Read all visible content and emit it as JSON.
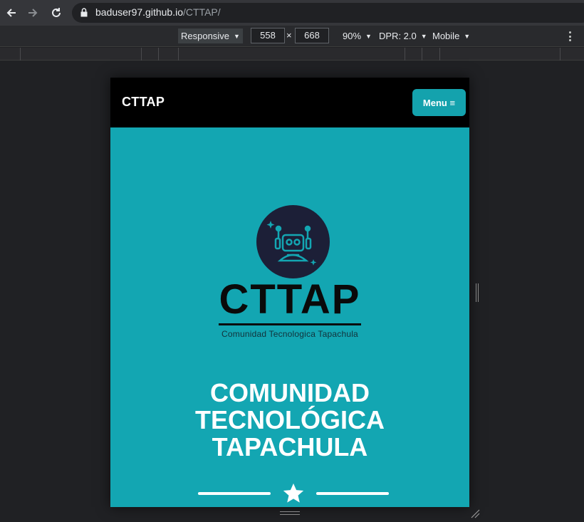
{
  "browser": {
    "url_host": "baduser97.github.io",
    "url_path": "/CTTAP/",
    "icons": [
      "back-arrow-icon",
      "forward-arrow-icon",
      "reload-icon",
      "lock-icon"
    ]
  },
  "device_toolbar": {
    "mode": "Responsive",
    "width": "558",
    "times": "×",
    "height": "668",
    "zoom": "90%",
    "dpr": "DPR: 2.0",
    "device_type": "Mobile"
  },
  "site": {
    "brand": "CTTAP",
    "menu_label": "Menu ≡",
    "logo_text": "CTTAP",
    "logo_subtitle": "Comunidad Tecnologica Tapachula",
    "headline_lines": [
      "COMUNIDAD",
      "TECNOLÓGICA",
      "TAPACHULA"
    ],
    "colors": {
      "primary": "#13a6b2",
      "navbar": "#000000",
      "logo_circle": "#1c1f37"
    }
  }
}
